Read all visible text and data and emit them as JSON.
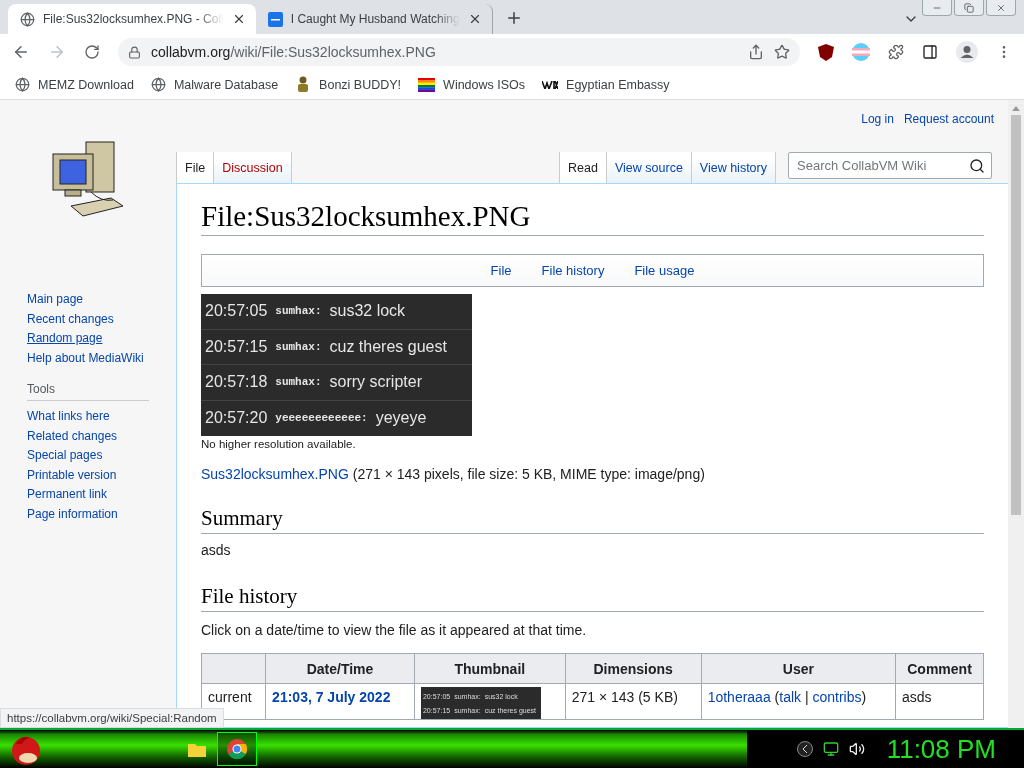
{
  "browser": {
    "tabs": [
      {
        "title": "File:Sus32locksumhex.PNG - Coll",
        "kind": "globe",
        "selected": true
      },
      {
        "title": "I Caught My Husband Watching",
        "kind": "square",
        "selected": false
      }
    ],
    "address": {
      "domain": "collabvm.org",
      "path": "/wiki/File:Sus32locksumhex.PNG"
    },
    "bookmarks": [
      {
        "label": "MEMZ Download",
        "kind": "globe"
      },
      {
        "label": "Malware Database",
        "kind": "globe"
      },
      {
        "label": "Bonzi BUDDY!",
        "kind": "figure"
      },
      {
        "label": "Windows ISOs",
        "kind": "rainbow"
      },
      {
        "label": "Egyptian Embassy",
        "kind": "mark"
      }
    ]
  },
  "wiki": {
    "personal_links": [
      "Log in",
      "Request account"
    ],
    "left_tabs": [
      {
        "label": "File",
        "selected": true
      },
      {
        "label": "Discussion",
        "selected": false
      }
    ],
    "right_tabs": [
      {
        "label": "Read",
        "selected": true
      },
      {
        "label": "View source",
        "selected": false
      },
      {
        "label": "View history",
        "selected": false
      }
    ],
    "search": {
      "placeholder": "Search CollabVM Wiki"
    },
    "navigation": [
      "Main page",
      "Recent changes",
      "Random page",
      "Help about MediaWiki"
    ],
    "tools_heading": "Tools",
    "tools": [
      "What links here",
      "Related changes",
      "Special pages",
      "Printable version",
      "Permanent link",
      "Page information"
    ],
    "title": "File:Sus32locksumhex.PNG",
    "file_nav": [
      "File",
      "File history",
      "File usage"
    ],
    "image_lines": [
      {
        "time": "20:57:05",
        "user": "sumhax:",
        "message": "sus32 lock"
      },
      {
        "time": "20:57:15",
        "user": "sumhax:",
        "message": "cuz theres guest"
      },
      {
        "time": "20:57:18",
        "user": "sumhax:",
        "message": "sorry scripter"
      },
      {
        "time": "20:57:20",
        "user": "yeeeeeeeeeeee:",
        "message": "yeyeye"
      }
    ],
    "resolution_note": "No higher resolution available.",
    "file_link": "Sus32locksumhex.PNG",
    "file_details": " (271 × 143 pixels, file size: 5 KB, MIME type: image/png)",
    "summary_heading": "Summary",
    "summary_text": "asds",
    "history_heading": "File history",
    "history_hint": "Click on a date/time to view the file as it appeared at that time.",
    "table": {
      "columns": [
        "",
        "Date/Time",
        "Thumbnail",
        "Dimensions",
        "User",
        "Comment"
      ],
      "rows": [
        {
          "version": "current",
          "datetime": "21:03, 7 July 2022",
          "thumbnail_lines": [
            {
              "time": "20:57:05",
              "user": "sumhax:",
              "message": "sus32 lock"
            },
            {
              "time": "20:57:15",
              "user": "sumhax:",
              "message": "cuz theres guest"
            }
          ],
          "dimensions": "271 × 143 (5 KB)",
          "user_parts": [
            {
              "text": "1otheraaa",
              "kind": "link"
            },
            {
              "text": " (",
              "kind": "plain"
            },
            {
              "text": "talk",
              "kind": "link"
            },
            {
              "text": " | ",
              "kind": "plain"
            },
            {
              "text": "contribs",
              "kind": "link"
            },
            {
              "text": ")",
              "kind": "plain"
            }
          ],
          "comment": "asds"
        }
      ]
    }
  },
  "status_url": "https://collabvm.org/wiki/Special:Random",
  "taskbar": {
    "clock": "11:08 PM"
  }
}
